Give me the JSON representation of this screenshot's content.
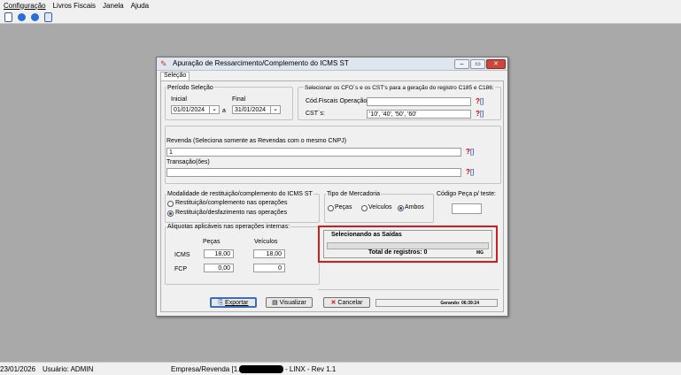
{
  "menu": {
    "items": [
      "Configuração",
      "Livros Fiscais",
      "Janela",
      "Ajuda"
    ]
  },
  "toolbar": {
    "icons": [
      "document-icon",
      "play-icon",
      "info-icon",
      "copy-icon"
    ]
  },
  "dialog": {
    "title": "Apuração de Ressarcimento/Complemento do ICMS ST",
    "tab": "Seleção",
    "periodo": {
      "legend": "Período Seleção",
      "inicial_label": "Inicial",
      "inicial_value": "01/01/2024",
      "a_label": "a",
      "final_label": "Final",
      "final_value": "31/01/2024"
    },
    "cfop": {
      "legend": "Selecionar os CFO´s e os CST's para a geração do registro C185 e C186:",
      "cod_label": "Cód.Fiscais Operação:",
      "cod_value": "",
      "cst_label": "CST´s:",
      "cst_value": "'10', '40', '50', '60'"
    },
    "revenda": {
      "label": "Revenda (Seleciona somente as Revendas com o mesmo CNPJ)",
      "value": "1",
      "transacao_label": "Transação(ões)",
      "transacao_value": ""
    },
    "modalidade": {
      "legend": "Modalidade de restituição/complemento do ICMS ST",
      "option1": "Restituição/complemento nas operações",
      "option2": "Restituição/desfazimento nas operações",
      "selected": 2
    },
    "tipo": {
      "legend": "Tipo de Mercadoria",
      "option1": "Peças",
      "option2": "Veículos",
      "option3": "Ambos",
      "selected": 3
    },
    "codigo_peca": {
      "legend": "Código Peça p/ teste:",
      "value": ""
    },
    "aliquotas": {
      "legend": "Aliquotas aplicáveis nas operações internas:",
      "col_pecas": "Peças",
      "col_veiculos": "Veículos",
      "row_icms": "ICMS",
      "row_fcp": "FCP",
      "icms_pecas": "18,00",
      "icms_veiculos": "18,00",
      "fcp_pecas": "0,00",
      "fcp_veiculos": "0"
    },
    "progress": {
      "title": "Selecionando as Saídas",
      "total_label": "Total de registros: 0",
      "badge": "MG",
      "fraction": 0
    },
    "buttons": {
      "exportar": "Exportar",
      "visualizar": "Visualizar",
      "cancelar": "Cancelar"
    },
    "gerando": "Gerando: 06:39:24",
    "q_mark": "?",
    "q_bracket": "[]"
  },
  "status": {
    "date": "23/01/2026",
    "user": "Usuário: ADMIN",
    "empresa": "Empresa/Revenda [1.1] -",
    "linx": "- LINX - Rev 1.1"
  },
  "colors": {
    "highlight_border": "#d21d1d",
    "close_button": "#c9483c"
  }
}
